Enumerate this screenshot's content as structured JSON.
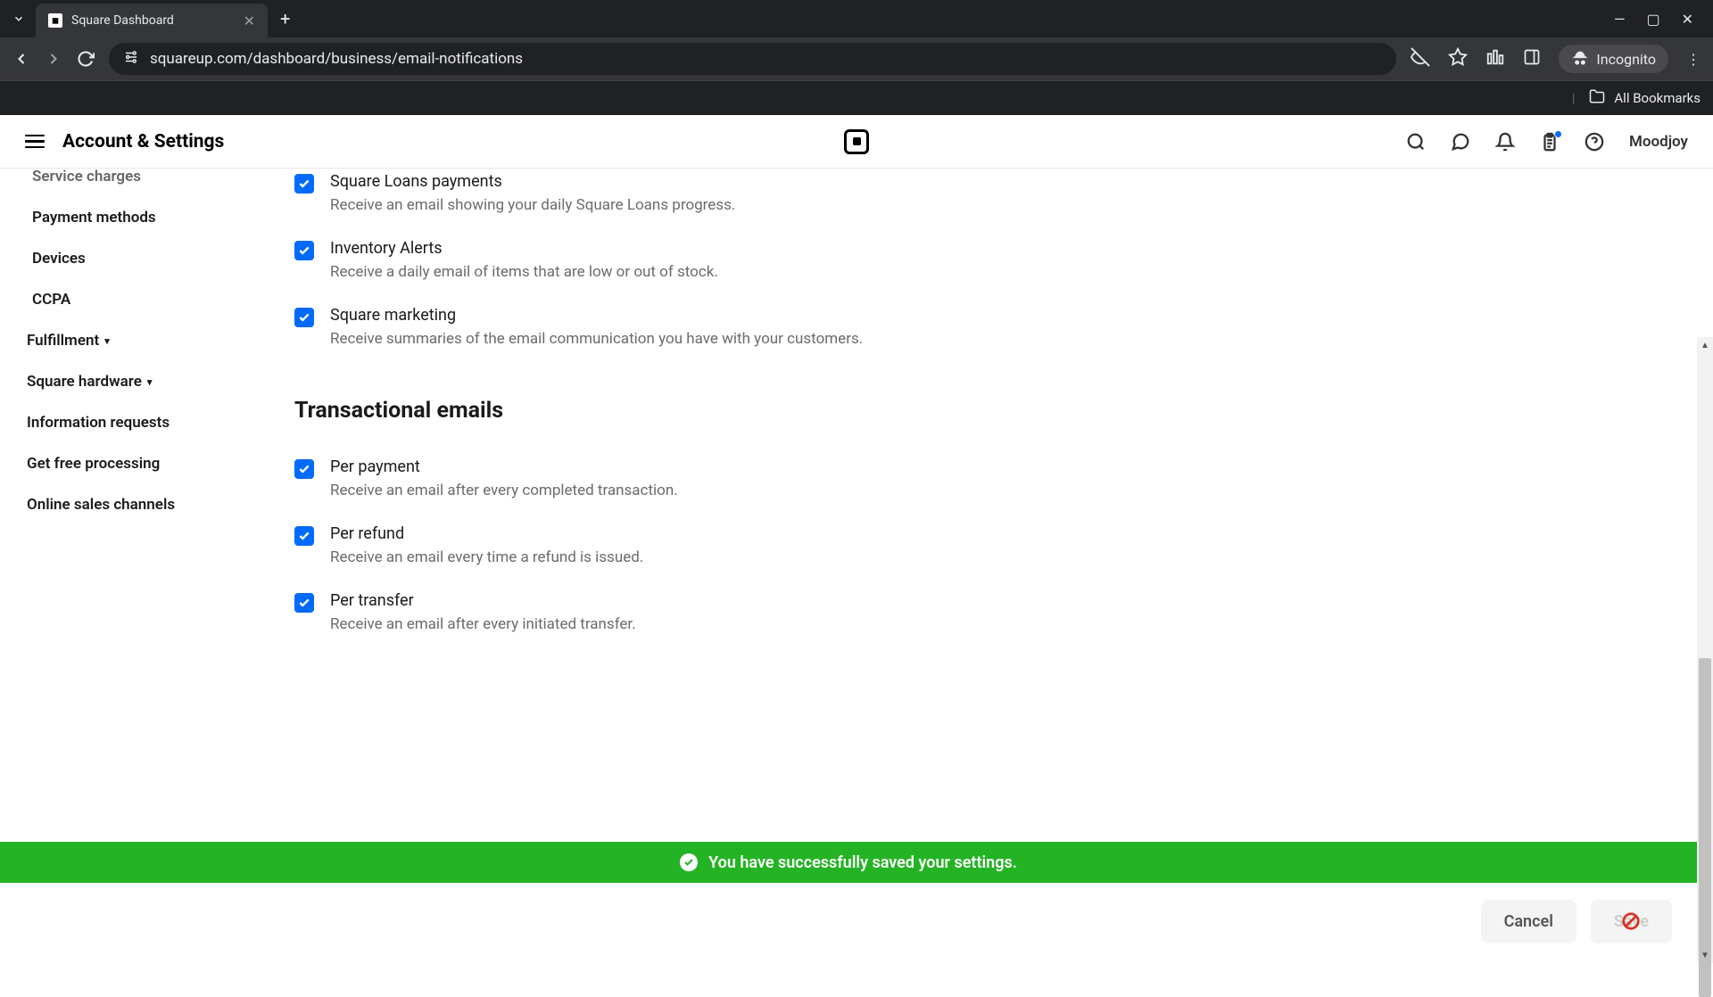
{
  "browser": {
    "tab_title": "Square Dashboard",
    "url": "squareup.com/dashboard/business/email-notifications",
    "incognito_label": "Incognito",
    "all_bookmarks": "All Bookmarks"
  },
  "header": {
    "title": "Account & Settings",
    "user": "Moodjoy"
  },
  "sidebar": {
    "items": [
      {
        "label": "Service charges"
      },
      {
        "label": "Payment methods"
      },
      {
        "label": "Devices"
      },
      {
        "label": "CCPA"
      },
      {
        "label": "Fulfillment",
        "expandable": true
      },
      {
        "label": "Square hardware",
        "expandable": true
      },
      {
        "label": "Information requests"
      },
      {
        "label": "Get free processing"
      },
      {
        "label": "Online sales channels"
      }
    ]
  },
  "settings": {
    "group1": [
      {
        "label": "Square Loans payments",
        "desc": "Receive an email showing your daily Square Loans progress."
      },
      {
        "label": "Inventory Alerts",
        "desc": "Receive a daily email of items that are low or out of stock."
      },
      {
        "label": "Square marketing",
        "desc": "Receive summaries of the email communication you have with your customers."
      }
    ],
    "section2_title": "Transactional emails",
    "group2": [
      {
        "label": "Per payment",
        "desc": "Receive an email after every completed transaction."
      },
      {
        "label": "Per refund",
        "desc": "Receive an email every time a refund is issued."
      },
      {
        "label": "Per transfer",
        "desc": "Receive an email after every initiated transfer."
      }
    ]
  },
  "banner": {
    "text": "You have successfully saved your settings."
  },
  "footer": {
    "cancel": "Cancel",
    "save": "Save"
  }
}
